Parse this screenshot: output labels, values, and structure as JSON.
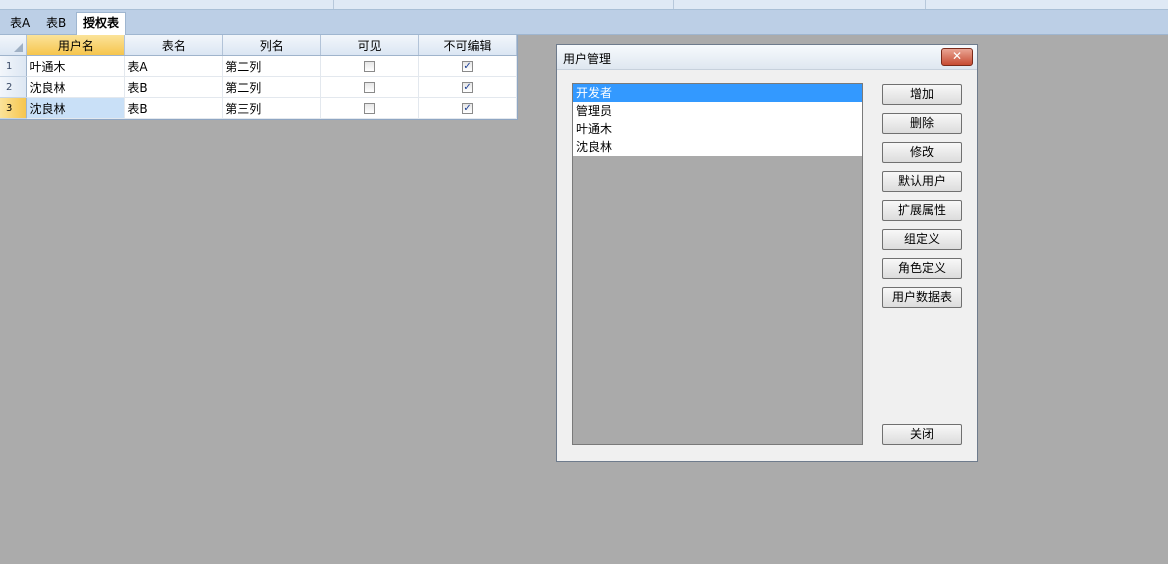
{
  "tabs": [
    {
      "label": "表A",
      "active": false
    },
    {
      "label": "表B",
      "active": false
    },
    {
      "label": "授权表",
      "active": true
    }
  ],
  "grid": {
    "columns": [
      "用户名",
      "表名",
      "列名",
      "可见",
      "不可编辑"
    ],
    "selected_column": "用户名",
    "rows": [
      {
        "num": "1",
        "user": "叶通木",
        "table": "表A",
        "col": "第二列",
        "visible": false,
        "readonly": true
      },
      {
        "num": "2",
        "user": "沈良林",
        "table": "表B",
        "col": "第二列",
        "visible": false,
        "readonly": true
      },
      {
        "num": "3",
        "user": "沈良林",
        "table": "表B",
        "col": "第三列",
        "visible": false,
        "readonly": true
      }
    ],
    "selected_row": "3"
  },
  "dialog": {
    "title": "用户管理",
    "close_glyph": "✕",
    "users": [
      "开发者",
      "管理员",
      "叶通木",
      "沈良林"
    ],
    "selected_user": "开发者",
    "buttons": {
      "add": "增加",
      "delete": "删除",
      "edit": "修改",
      "default_user": "默认用户",
      "ext_props": "扩展属性",
      "group_def": "组定义",
      "role_def": "角色定义",
      "user_datatable": "用户数据表",
      "close": "关闭"
    }
  },
  "colors": {
    "background": "#ababab",
    "selection": "#3399ff",
    "header_selected": "#f6c54d",
    "close_button": "#c74b32"
  }
}
